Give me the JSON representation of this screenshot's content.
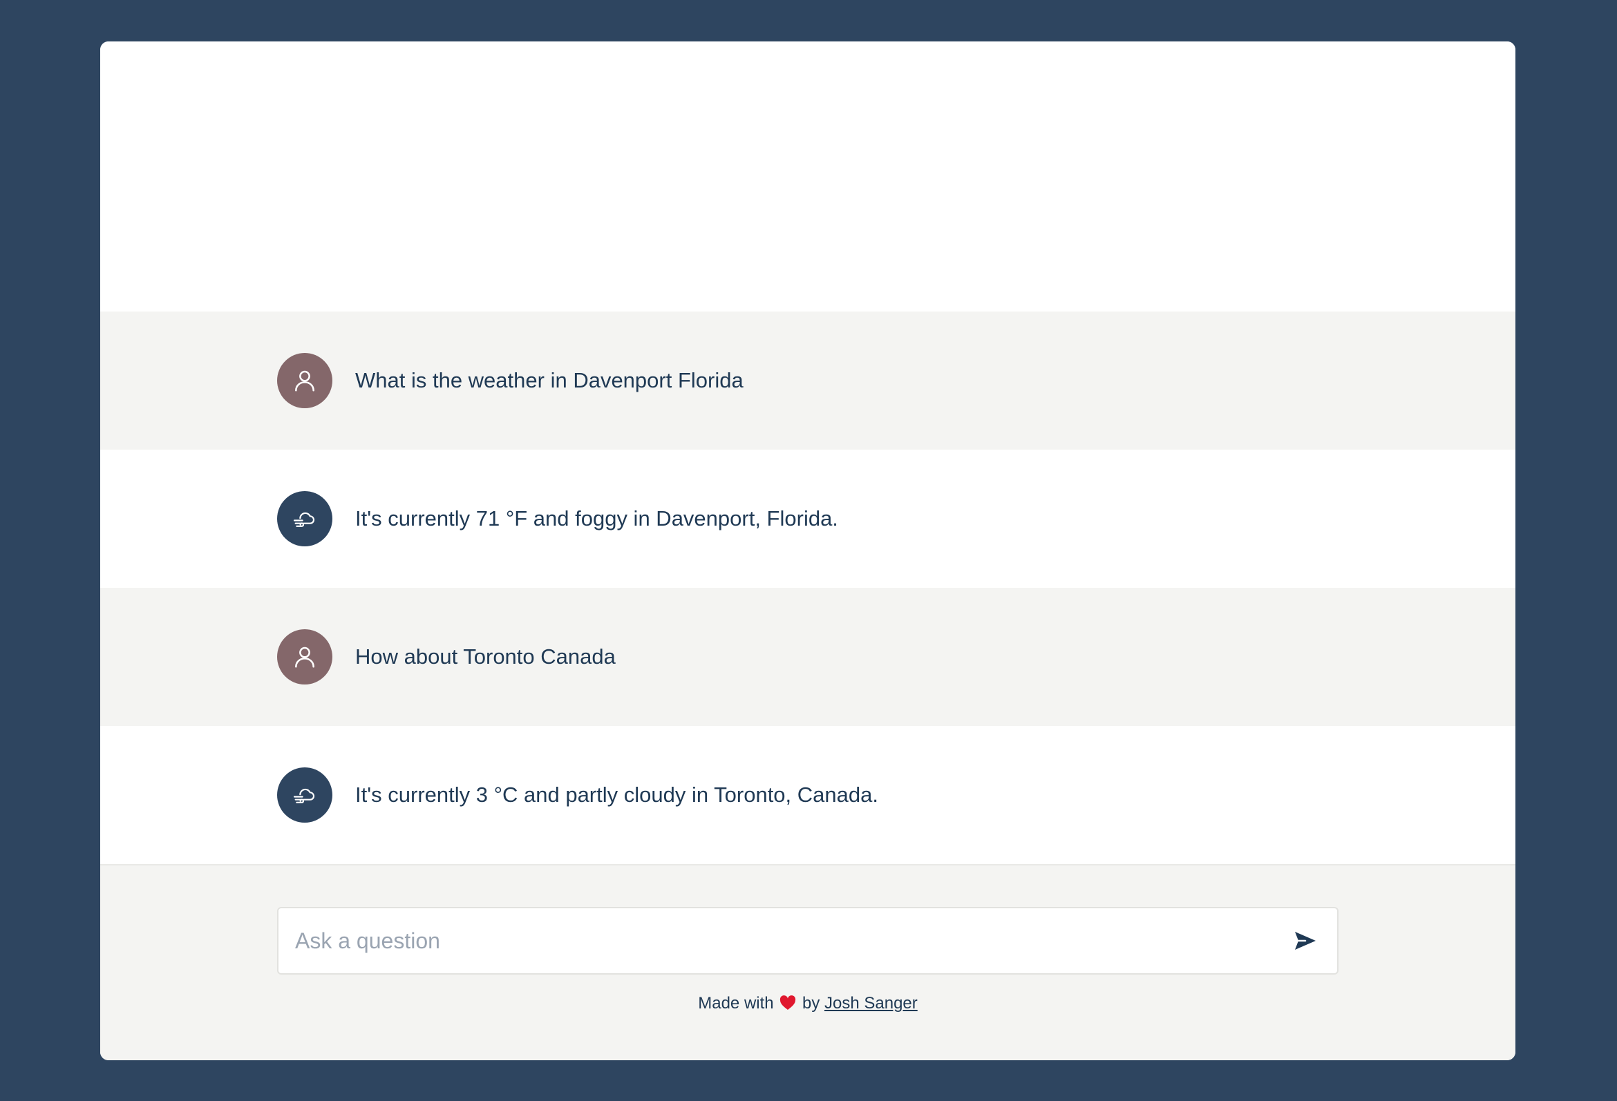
{
  "messages": [
    {
      "role": "user",
      "avatar_icon": "user-icon",
      "text": "What is the weather in Davenport Florida"
    },
    {
      "role": "assistant",
      "avatar_icon": "wind-cloud-icon",
      "text": "It's currently 71 °F and foggy in Davenport, Florida."
    },
    {
      "role": "user",
      "avatar_icon": "user-icon",
      "text": "How about Toronto Canada"
    },
    {
      "role": "assistant",
      "avatar_icon": "wind-cloud-icon",
      "text": "It's currently 3 °C and partly cloudy in Toronto, Canada."
    }
  ],
  "composer": {
    "placeholder": "Ask a question",
    "value": "",
    "send_icon": "send-icon"
  },
  "footer": {
    "made_with": "Made with",
    "heart_icon": "heart-icon",
    "by": "by",
    "author": "Josh Sanger"
  },
  "colors": {
    "page_background": "#2e4560",
    "user_avatar": "#84676a",
    "assistant_avatar": "#2e4560",
    "user_row": "#f4f4f2",
    "text": "#1f3954",
    "heart": "#e0182e"
  }
}
